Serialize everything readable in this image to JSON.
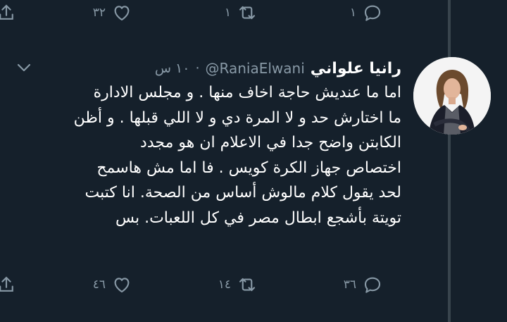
{
  "previous_tweet": {
    "actions": {
      "reply_count": "١",
      "retweet_count": "١",
      "like_count": "٣٢",
      "share_icon": "share-icon"
    }
  },
  "tweet": {
    "display_name": "رانيا علواني",
    "handle": "@RaniaElwani",
    "separator": "·",
    "time": "١٠ س",
    "text_lines": [
      "اما ما عنديش حاجة اخاف منها .   و مجلس الادارة",
      "ما اختارش حد و لا المرة دي و لا اللي قبلها . و أظن",
      "الكابتن واضح جدا في الاعلام ان هو مجدد",
      "اختصاص جهاز الكرة كويس . فا اما مش هاسمح",
      "لحد يقول كلام مالوش أساس من الصحة. انا كتبت",
      "تويتة بأشجع ابطال مصر في كل اللعبات.  بس"
    ],
    "actions": {
      "reply_count": "٣٦",
      "retweet_count": "١٤",
      "like_count": "٤٦"
    }
  },
  "colors": {
    "background": "#15202b",
    "text": "#ffffff",
    "secondary_text": "#8899a6",
    "thread_line": "#38444d"
  }
}
